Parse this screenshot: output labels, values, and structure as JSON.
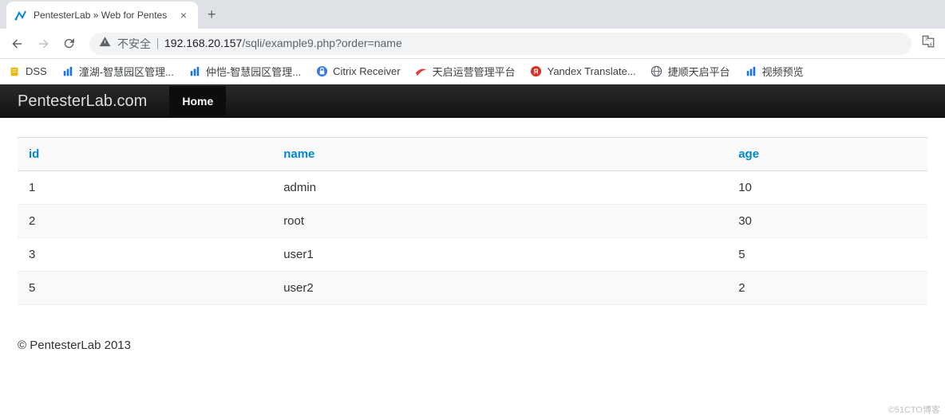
{
  "browser": {
    "tab_title": "PentesterLab » Web for Pentes",
    "new_tab": "+",
    "close": "×",
    "security_label": "不安全",
    "url_host": "192.168.20.157",
    "url_path": "/sqli/example9.php?order=name"
  },
  "bookmarks": [
    {
      "label": "DSS",
      "icon": "doc",
      "color": "#f0b500"
    },
    {
      "label": "潼湖-智慧园区管理...",
      "icon": "bars",
      "color": "#1a73e8"
    },
    {
      "label": "仲恺-智慧园区管理...",
      "icon": "bars",
      "color": "#1a73e8"
    },
    {
      "label": "Citrix Receiver",
      "icon": "lock-circle",
      "color": "#3b78e7"
    },
    {
      "label": "天启运营管理平台",
      "icon": "swoosh",
      "color": "#e53935"
    },
    {
      "label": "Yandex Translate...",
      "icon": "badge-y",
      "color": "#d93025"
    },
    {
      "label": "捷顺天启平台",
      "icon": "globe",
      "color": "#5f6368"
    },
    {
      "label": "视频预览",
      "icon": "bars",
      "color": "#1a73e8"
    }
  ],
  "page": {
    "brand": "PentesterLab.com",
    "nav_home": "Home",
    "footer": "© PentesterLab 2013",
    "watermark": "©51CTO博客",
    "table": {
      "headers": {
        "id": "id",
        "name": "name",
        "age": "age"
      },
      "rows": [
        {
          "id": "1",
          "name": "admin",
          "age": "10"
        },
        {
          "id": "2",
          "name": "root",
          "age": "30"
        },
        {
          "id": "3",
          "name": "user1",
          "age": "5"
        },
        {
          "id": "5",
          "name": "user2",
          "age": "2"
        }
      ]
    }
  }
}
